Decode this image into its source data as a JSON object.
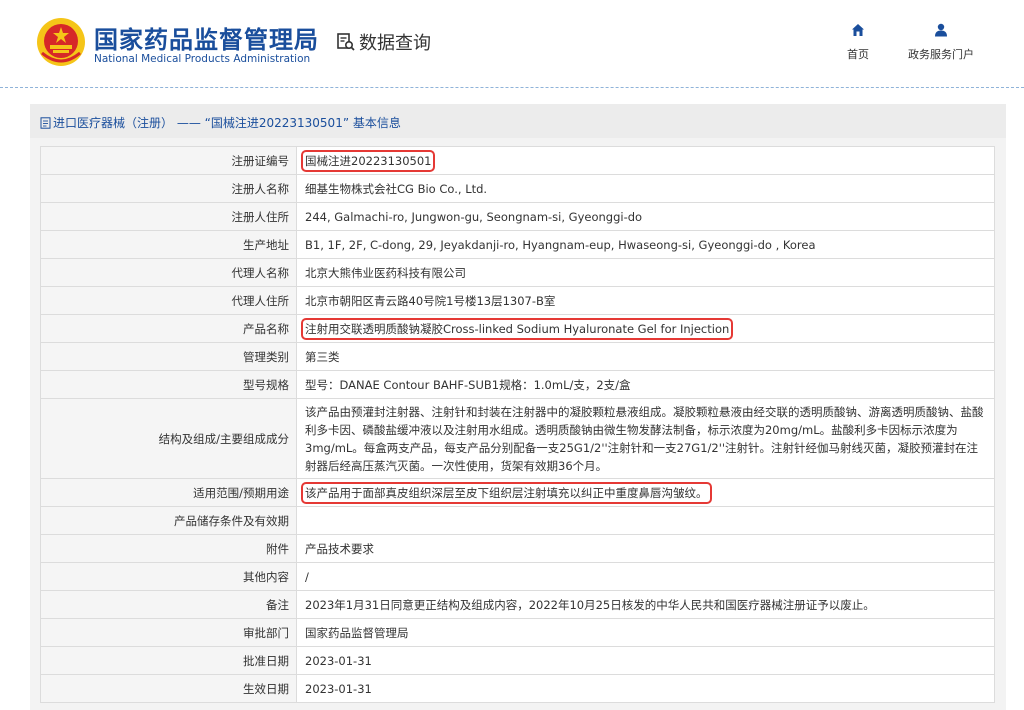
{
  "header": {
    "brand_cn": "国家药品监督管理局",
    "brand_en": "National Medical Products Administration",
    "query_label": "数据查询",
    "nav": [
      {
        "label": "首页",
        "icon": "home-icon"
      },
      {
        "label": "政务服务门户",
        "icon": "user-icon"
      }
    ]
  },
  "section": {
    "title": "进口医疗器械（注册） —— “国械注进20223130501” 基本信息"
  },
  "colors": {
    "brand": "#1a4e9c",
    "highlight": "#e53935"
  },
  "rows": [
    {
      "label": "注册证编号",
      "value": "国械注进20223130501",
      "highlight": true
    },
    {
      "label": "注册人名称",
      "value": "细基生物株式会社CG Bio Co., Ltd.",
      "highlight": false
    },
    {
      "label": "注册人住所",
      "value": "244, Galmachi-ro, Jungwon-gu, Seongnam-si, Gyeonggi-do",
      "highlight": false
    },
    {
      "label": "生产地址",
      "value": "B1, 1F, 2F, C-dong, 29, Jeyakdanji-ro, Hyangnam-eup, Hwaseong-si, Gyeonggi-do , Korea",
      "highlight": false
    },
    {
      "label": "代理人名称",
      "value": "北京大熊伟业医药科技有限公司",
      "highlight": false
    },
    {
      "label": "代理人住所",
      "value": "北京市朝阳区青云路40号院1号楼13层1307-B室",
      "highlight": false
    },
    {
      "label": "产品名称",
      "value": "注射用交联透明质酸钠凝胶Cross-linked Sodium Hyaluronate Gel for Injection",
      "highlight": true
    },
    {
      "label": "管理类别",
      "value": "第三类",
      "highlight": false
    },
    {
      "label": "型号规格",
      "value": "型号：DANAE Contour BAHF-SUB1规格：1.0mL/支，2支/盒",
      "highlight": false
    },
    {
      "label": "结构及组成/主要组成成分",
      "value": "该产品由预灌封注射器、注射针和封装在注射器中的凝胶颗粒悬液组成。凝胶颗粒悬液由经交联的透明质酸钠、游离透明质酸钠、盐酸利多卡因、磷酸盐缓冲液以及注射用水组成。透明质酸钠由微生物发酵法制备，标示浓度为20mg/mL。盐酸利多卡因标示浓度为3mg/mL。每盒两支产品，每支产品分别配备一支25G1/2''注射针和一支27G1/2''注射针。注射针经伽马射线灭菌，凝胶预灌封在注射器后经高压蒸汽灭菌。一次性使用，货架有效期36个月。",
      "highlight": false
    },
    {
      "label": "适用范围/预期用途",
      "value": "该产品用于面部真皮组织深层至皮下组织层注射填充以纠正中重度鼻唇沟皱纹。",
      "highlight": true
    },
    {
      "label": "产品储存条件及有效期",
      "value": "",
      "highlight": false
    },
    {
      "label": "附件",
      "value": "产品技术要求",
      "highlight": false
    },
    {
      "label": "其他内容",
      "value": "/",
      "highlight": false
    },
    {
      "label": "备注",
      "value": "2023年1月31日同意更正结构及组成内容，2022年10月25日核发的中华人民共和国医疗器械注册证予以废止。",
      "highlight": false
    },
    {
      "label": "审批部门",
      "value": "国家药品监督管理局",
      "highlight": false
    },
    {
      "label": "批准日期",
      "value": "2023-01-31",
      "highlight": false
    },
    {
      "label": "生效日期",
      "value": "2023-01-31",
      "highlight": false
    }
  ]
}
